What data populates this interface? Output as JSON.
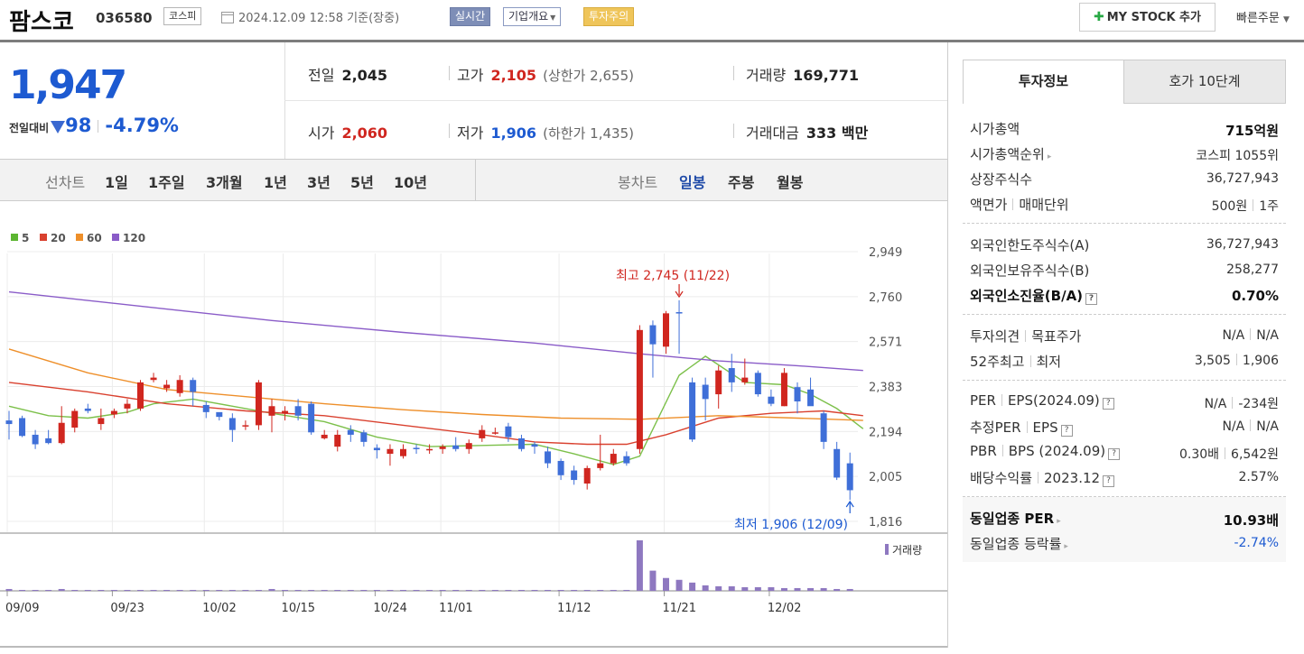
{
  "header": {
    "stock_name": "팜스코",
    "stock_code": "036580",
    "market": "코스피",
    "datetime": "2024.12.09 12:58 기준(장중)",
    "realtime_label": "실시간",
    "company_info_label": "기업개요",
    "warning_label": "투자주의",
    "mystock_label": "MY STOCK 추가",
    "quick_order_label": "빠른주문"
  },
  "price": {
    "current": "1,947",
    "diff_label": "전일대비",
    "diff_value": "98",
    "diff_pct": "-4.79%",
    "prev_label": "전일",
    "prev_value": "2,045",
    "open_label": "시가",
    "open_value": "2,060",
    "high_label": "고가",
    "high_value": "2,105",
    "upper_limit": "(상한가 2,655)",
    "low_label": "저가",
    "low_value": "1,906",
    "lower_limit": "(하한가 1,435)",
    "volume_label": "거래량",
    "volume_value": "169,771",
    "amount_label": "거래대금",
    "amount_value": "333 백만"
  },
  "period_tabs": {
    "line_label": "선차트",
    "line_items": [
      "1일",
      "1주일",
      "3개월",
      "1년",
      "3년",
      "5년",
      "10년"
    ],
    "candle_label": "봉차트",
    "candle_items": [
      "일봉",
      "주봉",
      "월봉"
    ],
    "candle_active": "일봉"
  },
  "chart_data": {
    "type": "candlestick",
    "legend": [
      {
        "name": "5",
        "color": "#5cb531"
      },
      {
        "name": "20",
        "color": "#d9412f"
      },
      {
        "name": "60",
        "color": "#ee8f2a"
      },
      {
        "name": "120",
        "color": "#8a5cc8"
      }
    ],
    "y_ticks": [
      "2,949",
      "2,760",
      "2,571",
      "2,383",
      "2,194",
      "2,005",
      "1,816"
    ],
    "ylim": [
      1816,
      2949
    ],
    "x_ticks": [
      "09/09",
      "09/23",
      "10/02",
      "10/15",
      "10/24",
      "11/01",
      "11/12",
      "11/21",
      "12/02"
    ],
    "high_annotation": "최고 2,745 (11/22)",
    "low_annotation": "최저 1,906 (12/09)",
    "volume_label": "거래량",
    "up_color": "#d0261f",
    "down_color": "#3f6fd8",
    "volume_color": "#8e78c0",
    "candles": [
      [
        2240,
        2225,
        2280,
        2160
      ],
      [
        2250,
        2175,
        2260,
        2170
      ],
      [
        2180,
        2140,
        2200,
        2120
      ],
      [
        2165,
        2145,
        2200,
        2140
      ],
      [
        2145,
        2230,
        2300,
        2140
      ],
      [
        2210,
        2280,
        2290,
        2190
      ],
      [
        2290,
        2280,
        2310,
        2270
      ],
      [
        2225,
        2250,
        2290,
        2200
      ],
      [
        2265,
        2280,
        2290,
        2250
      ],
      [
        2290,
        2310,
        2330,
        2270
      ],
      [
        2290,
        2400,
        2410,
        2280
      ],
      [
        2410,
        2420,
        2440,
        2400
      ],
      [
        2375,
        2390,
        2410,
        2360
      ],
      [
        2355,
        2410,
        2430,
        2340
      ],
      [
        2410,
        2360,
        2420,
        2300
      ],
      [
        2305,
        2275,
        2320,
        2250
      ],
      [
        2275,
        2255,
        2270,
        2240
      ],
      [
        2250,
        2200,
        2270,
        2150
      ],
      [
        2215,
        2220,
        2240,
        2200
      ],
      [
        2220,
        2400,
        2410,
        2200
      ],
      [
        2260,
        2300,
        2330,
        2190
      ],
      [
        2270,
        2280,
        2300,
        2240
      ],
      [
        2300,
        2260,
        2330,
        2240
      ],
      [
        2310,
        2190,
        2320,
        2180
      ],
      [
        2165,
        2180,
        2200,
        2160
      ],
      [
        2130,
        2180,
        2200,
        2110
      ],
      [
        2200,
        2180,
        2220,
        2150
      ],
      [
        2190,
        2150,
        2200,
        2130
      ],
      [
        2125,
        2115,
        2140,
        2080
      ],
      [
        2100,
        2120,
        2140,
        2050
      ],
      [
        2090,
        2120,
        2140,
        2080
      ],
      [
        2125,
        2120,
        2140,
        2100
      ],
      [
        2120,
        2120,
        2140,
        2100
      ],
      [
        2120,
        2130,
        2140,
        2100
      ],
      [
        2135,
        2120,
        2170,
        2110
      ],
      [
        2120,
        2145,
        2160,
        2100
      ],
      [
        2165,
        2200,
        2220,
        2150
      ],
      [
        2190,
        2190,
        2210,
        2180
      ],
      [
        2215,
        2170,
        2230,
        2150
      ],
      [
        2165,
        2120,
        2180,
        2110
      ],
      [
        2140,
        2130,
        2150,
        2100
      ],
      [
        2110,
        2060,
        2130,
        2040
      ],
      [
        2070,
        2010,
        2080,
        1990
      ],
      [
        2030,
        1990,
        2050,
        1970
      ],
      [
        1975,
        2040,
        2050,
        1950
      ],
      [
        2040,
        2060,
        2180,
        2030
      ],
      [
        2060,
        2100,
        2120,
        2050
      ],
      [
        2090,
        2060,
        2110,
        2050
      ],
      [
        2120,
        2620,
        2640,
        2100
      ],
      [
        2640,
        2560,
        2660,
        2420
      ],
      [
        2550,
        2690,
        2700,
        2520
      ],
      [
        2695,
        2690,
        2745,
        2520
      ],
      [
        2400,
        2160,
        2420,
        2150
      ],
      [
        2390,
        2330,
        2420,
        2240
      ],
      [
        2350,
        2450,
        2470,
        2290
      ],
      [
        2460,
        2400,
        2520,
        2360
      ],
      [
        2400,
        2420,
        2500,
        2390
      ],
      [
        2440,
        2350,
        2450,
        2340
      ],
      [
        2340,
        2310,
        2370,
        2300
      ],
      [
        2300,
        2440,
        2460,
        2300
      ],
      [
        2380,
        2320,
        2400,
        2270
      ],
      [
        2370,
        2300,
        2420,
        2310
      ],
      [
        2270,
        2150,
        2280,
        2120
      ],
      [
        2120,
        2000,
        2150,
        1990
      ],
      [
        2060,
        1947,
        2105,
        1906
      ]
    ],
    "volumes": [
      2,
      1,
      1,
      1,
      2,
      1,
      1,
      1,
      1,
      1,
      1,
      1,
      1,
      1,
      1,
      1,
      1,
      1,
      1,
      1,
      2,
      1,
      1,
      1,
      1,
      1,
      1,
      1,
      1,
      1,
      1,
      1,
      1,
      1,
      1,
      1,
      1,
      1,
      1,
      1,
      1,
      1,
      1,
      1,
      1,
      1,
      1,
      1,
      55,
      22,
      14,
      12,
      9,
      6,
      5,
      5,
      4,
      4,
      4,
      3,
      3,
      3,
      3,
      2,
      2
    ],
    "ma_lines": {
      "ma5": [
        [
          0,
          2300
        ],
        [
          3,
          2260
        ],
        [
          6,
          2250
        ],
        [
          9,
          2275
        ],
        [
          11,
          2310
        ],
        [
          14,
          2330
        ],
        [
          17,
          2300
        ],
        [
          20,
          2270
        ],
        [
          24,
          2235
        ],
        [
          28,
          2170
        ],
        [
          32,
          2130
        ],
        [
          36,
          2135
        ],
        [
          40,
          2140
        ],
        [
          43,
          2100
        ],
        [
          46,
          2055
        ],
        [
          48,
          2090
        ],
        [
          51,
          2430
        ],
        [
          53,
          2510
        ],
        [
          56,
          2400
        ],
        [
          59,
          2390
        ],
        [
          61,
          2350
        ],
        [
          63,
          2290
        ],
        [
          65,
          2205
        ]
      ],
      "ma20": [
        [
          0,
          2400
        ],
        [
          6,
          2360
        ],
        [
          12,
          2310
        ],
        [
          18,
          2280
        ],
        [
          24,
          2260
        ],
        [
          30,
          2220
        ],
        [
          36,
          2180
        ],
        [
          40,
          2150
        ],
        [
          44,
          2140
        ],
        [
          47,
          2140
        ],
        [
          50,
          2180
        ],
        [
          54,
          2250
        ],
        [
          58,
          2270
        ],
        [
          62,
          2280
        ],
        [
          65,
          2260
        ]
      ],
      "ma60": [
        [
          0,
          2540
        ],
        [
          6,
          2440
        ],
        [
          12,
          2370
        ],
        [
          18,
          2340
        ],
        [
          24,
          2310
        ],
        [
          30,
          2285
        ],
        [
          36,
          2265
        ],
        [
          42,
          2250
        ],
        [
          48,
          2245
        ],
        [
          54,
          2260
        ],
        [
          60,
          2250
        ],
        [
          65,
          2240
        ]
      ],
      "ma120": [
        [
          0,
          2780
        ],
        [
          10,
          2720
        ],
        [
          20,
          2660
        ],
        [
          30,
          2610
        ],
        [
          40,
          2565
        ],
        [
          48,
          2520
        ],
        [
          54,
          2490
        ],
        [
          60,
          2470
        ],
        [
          65,
          2450
        ]
      ]
    }
  },
  "invest_panel": {
    "tab_active": "투자정보",
    "tab_other": "호가 10단계",
    "sec1": [
      {
        "k": "시가총액",
        "v": "715억원"
      },
      {
        "k": "시가총액순위",
        "v": "코스피 1055위"
      },
      {
        "k": "상장주식수",
        "v": "36,727,943"
      },
      {
        "k": "액면가",
        "k2": "매매단위",
        "v": "500원",
        "v2": "1주"
      }
    ],
    "sec2": [
      {
        "k": "외국인한도주식수(A)",
        "v": "36,727,943"
      },
      {
        "k": "외국인보유주식수(B)",
        "v": "258,277"
      },
      {
        "k": "외국인소진율(B/A)",
        "v": "0.70%"
      }
    ],
    "sec3": [
      {
        "k": "투자의견",
        "k2": "목표주가",
        "v": "N/A",
        "v2": "N/A"
      },
      {
        "k": "52주최고",
        "k2": "최저",
        "v": "3,505",
        "v2": "1,906"
      }
    ],
    "sec4": [
      {
        "k": "PER",
        "k2": "EPS(2024.09)",
        "v": "N/A",
        "v2": "-234원"
      },
      {
        "k": "추정PER",
        "k2": "EPS",
        "v": "N/A",
        "v2": "N/A"
      },
      {
        "k": "PBR",
        "k2": "BPS (2024.09)",
        "v": "0.30배",
        "v2": "6,542원"
      },
      {
        "k": "배당수익률",
        "k2": "2023.12",
        "v": "2.57%"
      }
    ],
    "sec5": [
      {
        "k": "동일업종 PER",
        "v": "10.93배"
      },
      {
        "k": "동일업종 등락률",
        "v": "-2.74%"
      }
    ]
  }
}
